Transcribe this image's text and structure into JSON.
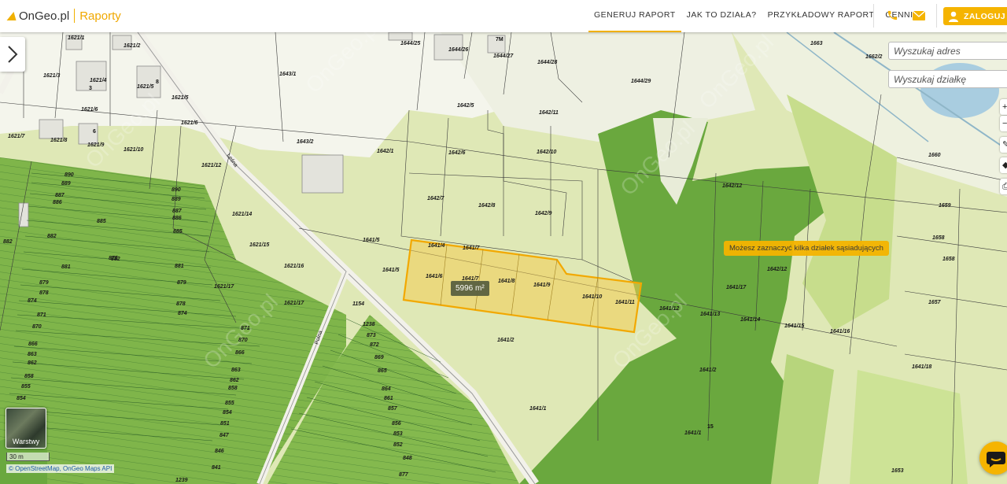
{
  "header": {
    "brand": "OnGeo.pl",
    "brand_sub": "Raporty",
    "nav": [
      "GENERUJ RAPORT",
      "JAK TO DZIAŁA?",
      "PRZYKŁADOWY RAPORT",
      "CENNIK"
    ],
    "login_label": "ZALOGUJ SI",
    "accent": "#f5b400"
  },
  "search": {
    "address_placeholder": "Wyszukaj adres",
    "parcel_placeholder": "Wyszukaj działkę"
  },
  "map": {
    "tooltip": "Możesz zaznaczyć kilka działek sąsiadujących",
    "area_label": "5996 m²",
    "layers_label": "Warstwy",
    "scale_label": "30 m",
    "attribution": "© OpenStreetMap, OnGeo Maps API",
    "streets": [
      "Leśna",
      "Polna"
    ],
    "building_numbers": [
      "3",
      "8",
      "6",
      "7M",
      "15"
    ],
    "parcel_labels": [
      "1621/1",
      "1621/2",
      "1621/3",
      "1621/4",
      "1621/5",
      "1621/6",
      "1621/7",
      "1621/8",
      "1621/9",
      "1621/10",
      "1621/12",
      "1621/14",
      "1621/15",
      "1621/16",
      "1621/17",
      "1621/5",
      "1621/6",
      "1621/17",
      "1643/1",
      "1643/2",
      "1644/25",
      "1644/26",
      "1644/27",
      "1644/28",
      "1644/29",
      "1642/1",
      "1642/5",
      "1642/6",
      "1642/7",
      "1642/8",
      "1642/9",
      "1642/10",
      "1642/11",
      "1642/12",
      "1642/12",
      "1641/1",
      "1641/1",
      "1641/2",
      "1641/2",
      "1641/4",
      "1641/5",
      "1641/5",
      "1641/6",
      "1641/7",
      "1641/7",
      "1641/8",
      "1641/9",
      "1641/10",
      "1641/11",
      "1641/12",
      "1641/13",
      "1641/14",
      "1641/15",
      "1641/16",
      "1641/17",
      "1641/18",
      "1662/2",
      "1663",
      "1660",
      "1659",
      "1658",
      "1658",
      "1657",
      "1653",
      "890",
      "889",
      "887",
      "886",
      "885",
      "882",
      "881",
      "879",
      "878",
      "874",
      "871",
      "870",
      "866",
      "863",
      "862",
      "858",
      "855",
      "854",
      "890",
      "889",
      "887",
      "886",
      "885",
      "882",
      "881",
      "879",
      "878",
      "874",
      "871",
      "870",
      "866",
      "863",
      "862",
      "858",
      "855",
      "854",
      "851",
      "847",
      "846",
      "841",
      "1239",
      "882",
      "875",
      "1238",
      "873",
      "872",
      "869",
      "865",
      "864",
      "861",
      "857",
      "856",
      "853",
      "852",
      "848",
      "877",
      "1154"
    ]
  }
}
